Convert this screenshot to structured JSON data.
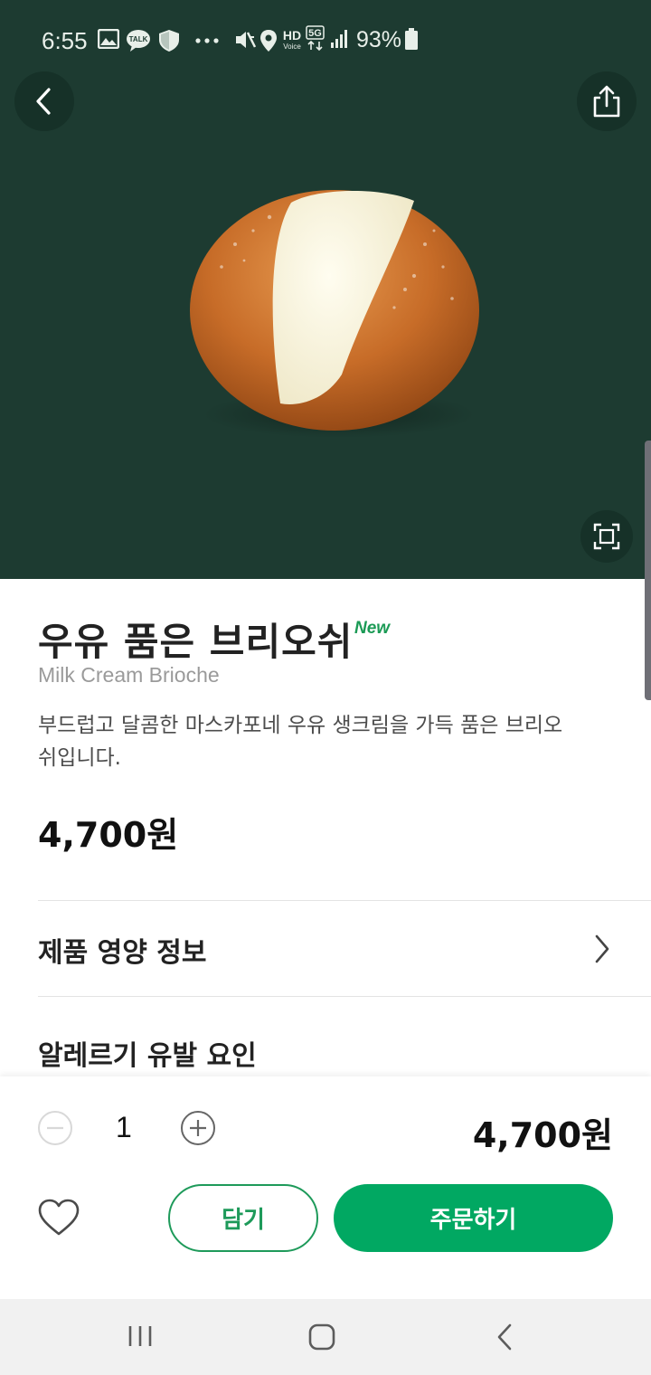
{
  "status_bar": {
    "time": "6:55",
    "battery": "93%",
    "icons": [
      "gallery-icon",
      "talk-icon",
      "shield-icon",
      "more-icon",
      "mute-icon",
      "location-icon",
      "hd-voice-icon",
      "5g-icon",
      "signal-icon",
      "battery-icon"
    ]
  },
  "hero": {
    "background_color": "#1d3b31",
    "image": "milk-cream-brioche-photo"
  },
  "product": {
    "name": "우유 품은 브리오쉬",
    "badge": "New",
    "english_name": "Milk Cream Brioche",
    "description": "부드럽고 달콤한 마스카포네 우유 생크림을 가득 품은 브리오쉬입니다.",
    "price": "4,700원"
  },
  "sections": {
    "nutrition": "제품 영양 정보",
    "allergy": "알레르기 유발 요인"
  },
  "order": {
    "quantity": "1",
    "total": "4,700원",
    "cart_label": "담기",
    "order_label": "주문하기",
    "accent_color": "#01a862"
  }
}
